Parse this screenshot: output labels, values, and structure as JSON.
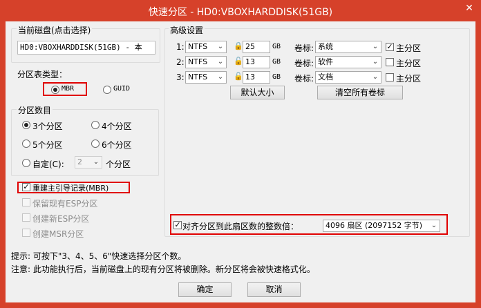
{
  "window": {
    "title": "快速分区 - HD0:VBOXHARDDISK(51GB)",
    "close_symbol": "✕"
  },
  "disk": {
    "label": "当前磁盘(点击选择)",
    "value": "HD0:VBOXHARDDISK(51GB) - 本"
  },
  "partition_table": {
    "label": "分区表类型：",
    "options": [
      "MBR",
      "GUID"
    ],
    "selected": "MBR"
  },
  "partition_count": {
    "label": "分区数目",
    "options": [
      "3个分区",
      "4个分区",
      "5个分区",
      "6个分区",
      "自定(C):"
    ],
    "selected": "3个分区",
    "custom_value": "2",
    "custom_suffix": "个分区"
  },
  "options": {
    "rebuild_mbr": "重建主引导记录(MBR)",
    "keep_esp": "保留现有ESP分区",
    "create_esp": "创建新ESP分区",
    "create_msr": "创建MSR分区"
  },
  "advanced": {
    "label": "高级设置",
    "volume_label_text": "卷标:",
    "primary_text": "主分区",
    "unit": "GB",
    "rows": [
      {
        "num": "1:",
        "fs": "NTFS",
        "size": "25",
        "label": "系统",
        "primary": true
      },
      {
        "num": "2:",
        "fs": "NTFS",
        "size": "13",
        "label": "软件",
        "primary": false
      },
      {
        "num": "3:",
        "fs": "NTFS",
        "size": "13",
        "label": "文档",
        "primary": false
      }
    ],
    "default_size_btn": "默认大小",
    "clear_labels_btn": "清空所有卷标"
  },
  "align": {
    "label": "对齐分区到此扇区数的整数倍：",
    "value": "4096 扇区 (2097152 字节)"
  },
  "tips": {
    "line1": "提示: 可按下\"3、4、5、6\"快速选择分区个数。",
    "line2": "注意: 此功能执行后，当前磁盘上的现有分区将被删除。新分区将会被快速格式化。"
  },
  "buttons": {
    "ok": "确定",
    "cancel": "取消"
  },
  "colors": {
    "title_bar": "#d6412a",
    "highlight": "#e00000"
  }
}
